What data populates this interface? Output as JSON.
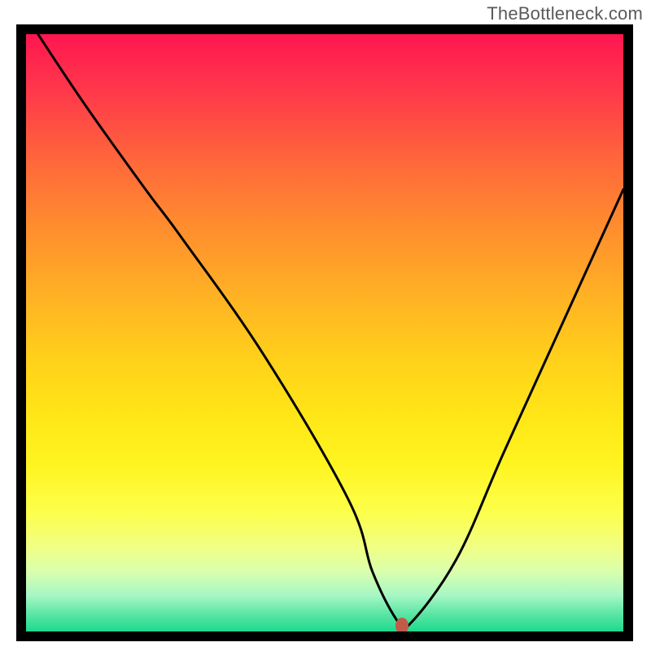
{
  "watermark": "TheBottleneck.com",
  "chart_data": {
    "type": "line",
    "title": "",
    "xlabel": "",
    "ylabel": "",
    "xlim": [
      0,
      100
    ],
    "ylim": [
      0,
      100
    ],
    "grid": false,
    "legend": false,
    "series": [
      {
        "name": "curve",
        "x": [
          2,
          10,
          20,
          26,
          40,
          54,
          58,
          62,
          64,
          72,
          80,
          90,
          100
        ],
        "y": [
          100,
          88,
          74,
          66,
          46,
          22,
          10,
          2,
          1,
          12,
          30,
          52,
          74
        ]
      }
    ],
    "marker": {
      "x": 63,
      "y": 1
    },
    "background": "rainbow-vertical"
  }
}
